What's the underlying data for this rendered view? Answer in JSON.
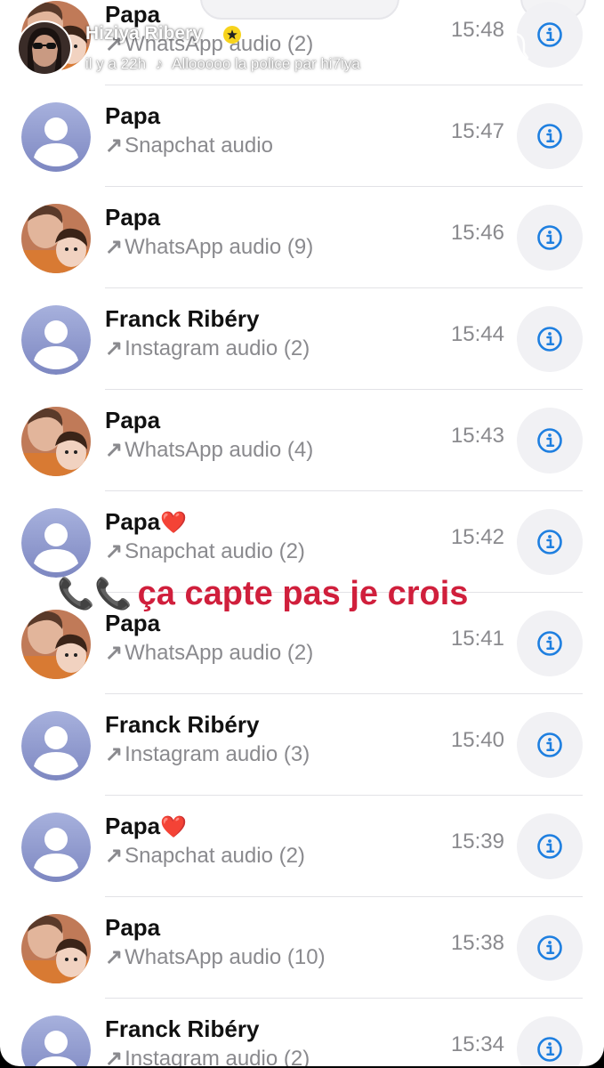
{
  "story": {
    "username": "Hiziya Ribery",
    "time_ago": "il y a 22h",
    "music": "Allooooo la police par hi7iya"
  },
  "caption": {
    "phones": "📞📞",
    "text": "ça capte pas je crois"
  },
  "calls": [
    {
      "name": "Papa",
      "heart": "",
      "direction": "↗",
      "type": "WhatsApp audio (2)",
      "time": "15:48",
      "avatar": "photo"
    },
    {
      "name": "Papa",
      "heart": "",
      "direction": "↗",
      "type": "Snapchat audio",
      "time": "15:47",
      "avatar": "default"
    },
    {
      "name": "Papa",
      "heart": "",
      "direction": "↗",
      "type": "WhatsApp audio (9)",
      "time": "15:46",
      "avatar": "photo"
    },
    {
      "name": "Franck Ribéry",
      "heart": "",
      "direction": "↗",
      "type": "Instagram audio (2)",
      "time": "15:44",
      "avatar": "default"
    },
    {
      "name": "Papa",
      "heart": "",
      "direction": "↗",
      "type": "WhatsApp audio (4)",
      "time": "15:43",
      "avatar": "photo"
    },
    {
      "name": "Papa",
      "heart": "❤️",
      "direction": "↗",
      "type": "Snapchat audio (2)",
      "time": "15:42",
      "avatar": "default"
    },
    {
      "name": "Papa",
      "heart": "",
      "direction": "↗",
      "type": "WhatsApp audio (2)",
      "time": "15:41",
      "avatar": "photo"
    },
    {
      "name": "Franck Ribéry",
      "heart": "",
      "direction": "↗",
      "type": "Instagram audio (3)",
      "time": "15:40",
      "avatar": "default"
    },
    {
      "name": "Papa",
      "heart": "❤️",
      "direction": "↗",
      "type": "Snapchat audio (2)",
      "time": "15:39",
      "avatar": "default"
    },
    {
      "name": "Papa",
      "heart": "",
      "direction": "↗",
      "type": "WhatsApp audio (10)",
      "time": "15:38",
      "avatar": "photo"
    },
    {
      "name": "Franck Ribéry",
      "heart": "",
      "direction": "↗",
      "type": "Instagram audio (2)",
      "time": "15:34",
      "avatar": "default"
    }
  ],
  "colors": {
    "info_blue": "#1e7fe0",
    "caption_red": "#d01f3c",
    "avatar_gradient_top": "#a7b1dd",
    "avatar_gradient_bottom": "#7d87c1"
  },
  "icons": {
    "info": "info-icon",
    "bell": "bell-icon",
    "outgoing": "outgoing-call-arrow-icon",
    "phone": "phone-icon",
    "verified": "star-badge-icon"
  }
}
